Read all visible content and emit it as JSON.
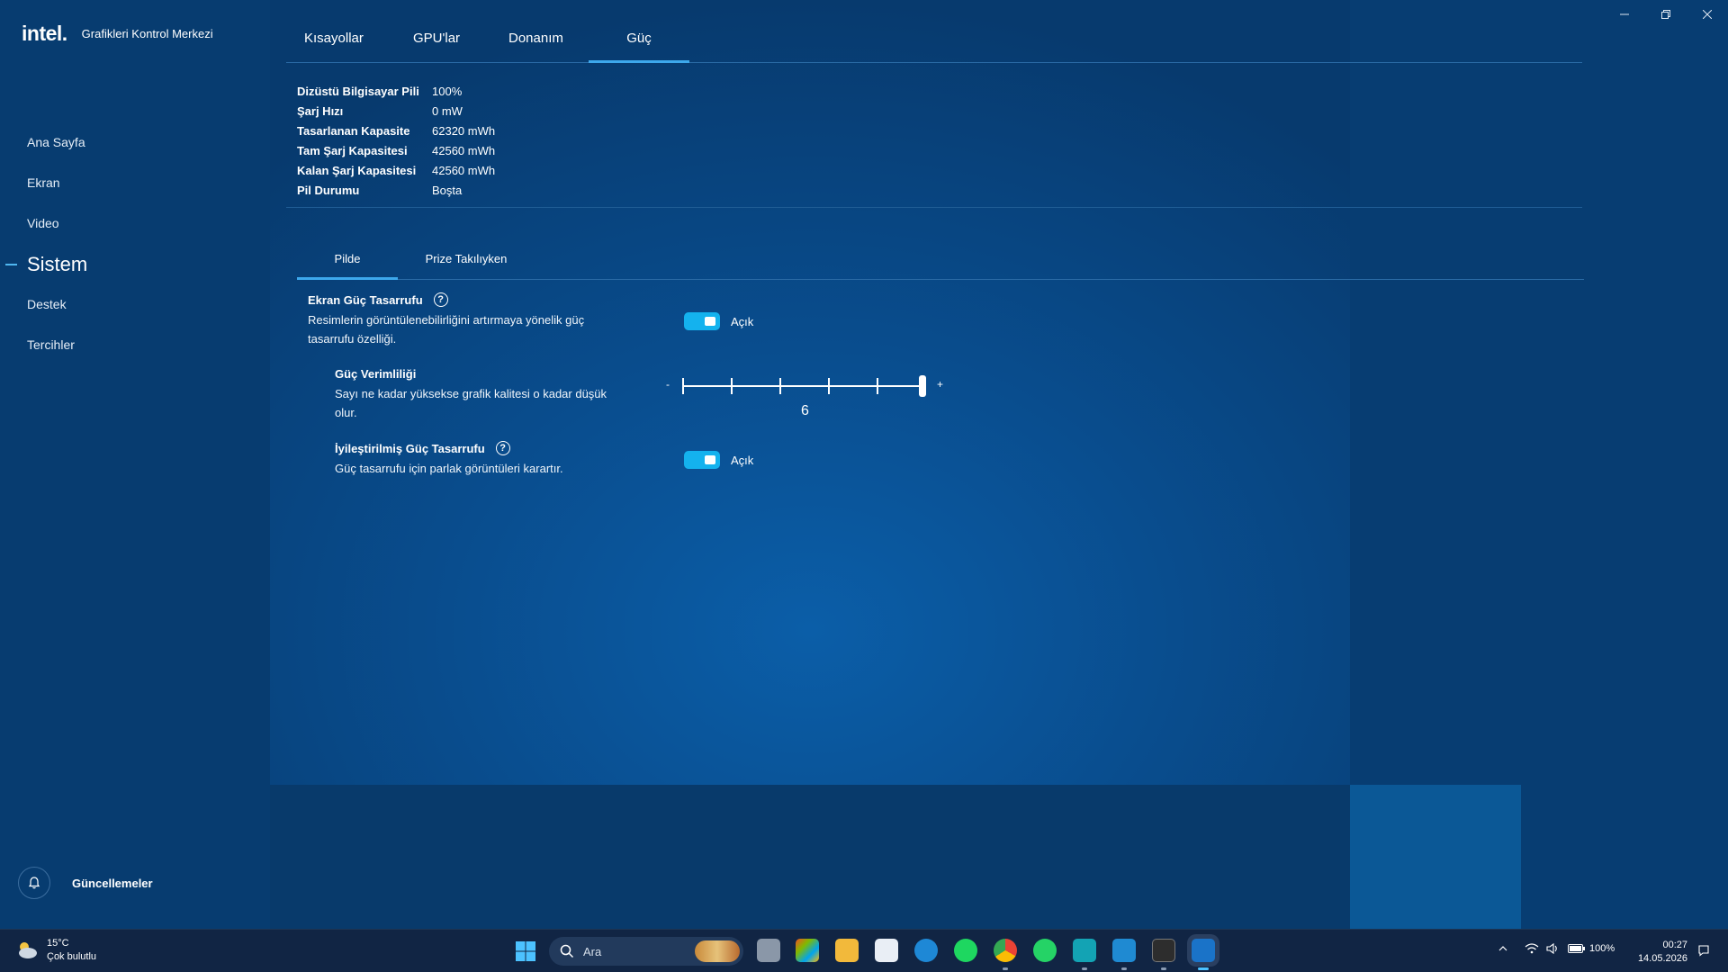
{
  "app": {
    "logo": "intel.",
    "title": "Grafikleri Kontrol Merkezi"
  },
  "sidebar": {
    "items": [
      {
        "label": "Ana Sayfa"
      },
      {
        "label": "Ekran"
      },
      {
        "label": "Video"
      },
      {
        "label": "Sistem"
      },
      {
        "label": "Destek"
      },
      {
        "label": "Tercihler"
      }
    ],
    "active": "Sistem",
    "updates_label": "Güncellemeler"
  },
  "top_tabs": [
    "Kısayollar",
    "GPU'lar",
    "Donanım",
    "Güç"
  ],
  "active_top_tab": "Güç",
  "battery": {
    "rows": [
      {
        "label": "Dizüstü Bilgisayar Pili",
        "value": "100%"
      },
      {
        "label": "Şarj Hızı",
        "value": "0 mW"
      },
      {
        "label": "Tasarlanan Kapasite",
        "value": "62320 mWh"
      },
      {
        "label": "Tam Şarj Kapasitesi",
        "value": "42560 mWh"
      },
      {
        "label": "Kalan Şarj Kapasitesi",
        "value": "42560 mWh"
      },
      {
        "label": "Pil Durumu",
        "value": "Boşta"
      }
    ]
  },
  "sub_tabs": [
    "Pilde",
    "Prize Takılıyken"
  ],
  "active_sub_tab": "Pilde",
  "settings": {
    "screen_power_saving": {
      "title": "Ekran Güç Tasarrufu",
      "desc_line1": "Resimlerin görüntülenebilirliğini artırmaya yönelik güç",
      "desc_line2": "tasarrufu özelliği.",
      "toggle_state": "Açık",
      "enabled": true
    },
    "power_efficiency": {
      "title": "Güç Verimliliği",
      "desc_line1": "Sayı ne kadar yüksekse grafik kalitesi o kadar düşük",
      "desc_line2": "olur.",
      "min_symbol": "-",
      "max_symbol": "+",
      "value": "6",
      "level": 6,
      "max_level": 6
    },
    "enhanced_power_saving": {
      "title": "İyileştirilmiş Güç Tasarrufu",
      "desc": "Güç tasarrufu için parlak görüntüleri karartır.",
      "toggle_state": "Açık",
      "enabled": true
    },
    "help_symbol": "?"
  },
  "taskbar": {
    "weather_temp": "15°C",
    "weather_desc": "Çok bulutlu",
    "search_placeholder": "Ara",
    "battery_percent": "100%",
    "time": "00:27",
    "date": "14.05.2026"
  },
  "colors": {
    "accent": "#14b2ee",
    "tab_underline": "#3da8ec",
    "sidebar_bg": "#073c70",
    "taskbar_bg": "#112544"
  }
}
